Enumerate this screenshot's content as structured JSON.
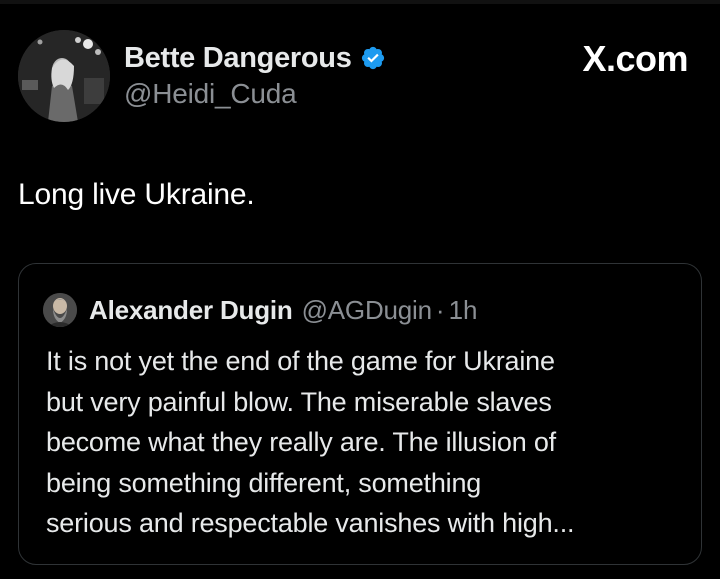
{
  "author": {
    "display_name": "Bette Dangerous",
    "handle": "@Heidi_Cuda",
    "avatar": "avatar-photo",
    "verified_icon": "verified-badge-icon",
    "verified_color": "#1d9bf0"
  },
  "brand": {
    "text": "X.com"
  },
  "tweet": {
    "text": "Long live Ukraine."
  },
  "quoted": {
    "display_name": "Alexander Dugin",
    "handle": "@AGDugin",
    "separator": "·",
    "time": "1h",
    "avatar": "avatar-photo",
    "lines": [
      "It is not yet the end of the game for Ukraine",
      "but very painful blow. The miserable slaves",
      "become what they really are. The illusion of",
      "being something different, something",
      "serious and respectable vanishes with high..."
    ]
  },
  "colors": {
    "background": "#000000",
    "text_primary": "#e7e9ea",
    "text_secondary": "#8b8f94",
    "border": "#2f3336"
  }
}
